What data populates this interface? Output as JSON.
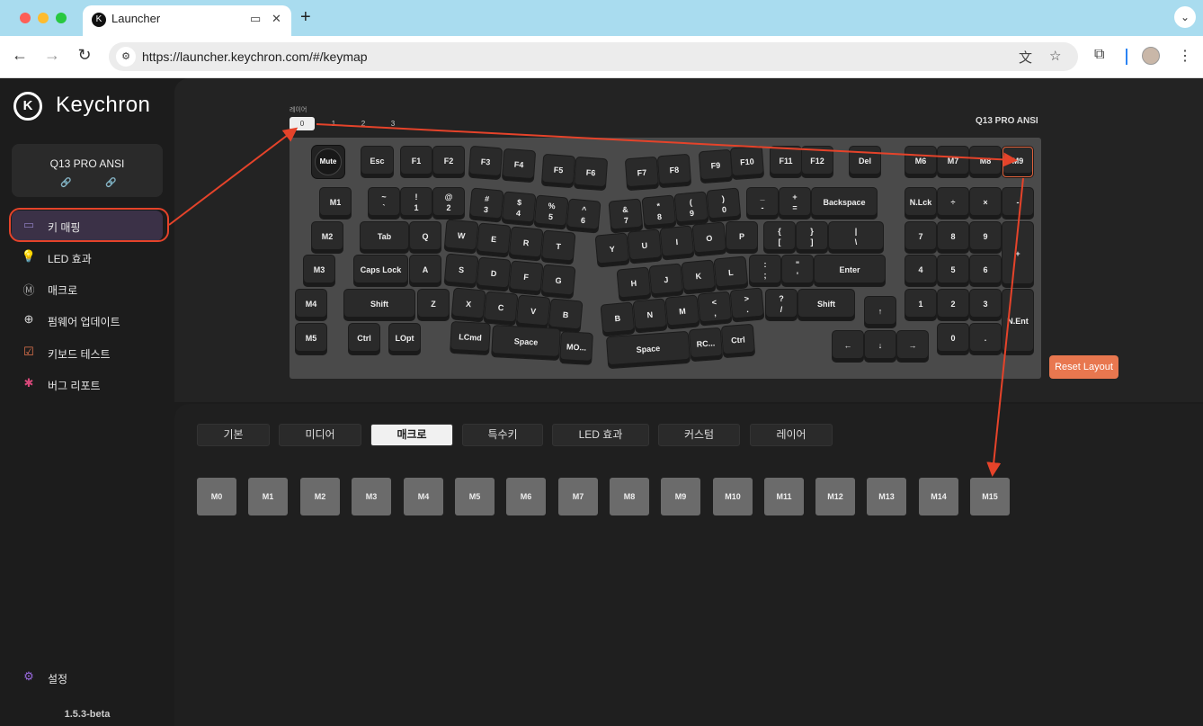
{
  "browser": {
    "tab_title": "Launcher",
    "url": "https://launcher.keychron.com/#/keymap"
  },
  "sidebar": {
    "brand": "Keychron",
    "device_name": "Q13 PRO ANSI",
    "items": [
      {
        "label": "키 매핑",
        "icon": "keyboard-icon"
      },
      {
        "label": "LED 효과",
        "icon": "bulb-icon"
      },
      {
        "label": "매크로",
        "icon": "macro-icon"
      },
      {
        "label": "펌웨어 업데이트",
        "icon": "firmware-icon"
      },
      {
        "label": "키보드 테스트",
        "icon": "checklist-icon"
      },
      {
        "label": "버그 리포트",
        "icon": "bug-icon"
      }
    ],
    "settings": "설정",
    "version": "1.5.3-beta"
  },
  "keymap": {
    "layer_label": "레이어",
    "layers": [
      "0",
      "1",
      "2",
      "3"
    ],
    "selected_layer": "0",
    "keyboard_title": "Q13 PRO ANSI",
    "knob_label": "Mute",
    "reset_label": "Reset Layout"
  },
  "keys": [
    {
      "label": "Esc"
    },
    {
      "label": "F1"
    },
    {
      "label": "F2"
    },
    {
      "label": "F3"
    },
    {
      "label": "F4"
    },
    {
      "label": "F5"
    },
    {
      "label": "F6"
    },
    {
      "label": "F7"
    },
    {
      "label": "F8"
    },
    {
      "label": "F9"
    },
    {
      "label": "F10"
    },
    {
      "label": "F11"
    },
    {
      "label": "F12"
    },
    {
      "label": "Del"
    },
    {
      "label": "M6"
    },
    {
      "label": "M7"
    },
    {
      "label": "M8"
    },
    {
      "label": "M9"
    },
    {
      "label": "M1"
    },
    {
      "label": "~\n`"
    },
    {
      "label": "!\n1"
    },
    {
      "label": "@\n2"
    },
    {
      "label": "#\n3"
    },
    {
      "label": "$\n4"
    },
    {
      "label": "%\n5"
    },
    {
      "label": "^\n6"
    },
    {
      "label": "&\n7"
    },
    {
      "label": "*\n8"
    },
    {
      "label": "(\n9"
    },
    {
      "label": ")\n0"
    },
    {
      "label": "_\n-"
    },
    {
      "label": "+\n="
    },
    {
      "label": "Backspace"
    },
    {
      "label": "N.Lck"
    },
    {
      "label": "÷"
    },
    {
      "label": "×"
    },
    {
      "label": "-"
    },
    {
      "label": "M2"
    },
    {
      "label": "Tab"
    },
    {
      "label": "Q"
    },
    {
      "label": "W"
    },
    {
      "label": "E"
    },
    {
      "label": "R"
    },
    {
      "label": "T"
    },
    {
      "label": "Y"
    },
    {
      "label": "U"
    },
    {
      "label": "I"
    },
    {
      "label": "O"
    },
    {
      "label": "P"
    },
    {
      "label": "{\n["
    },
    {
      "label": "}\n]"
    },
    {
      "label": "|\n\\"
    },
    {
      "label": "7"
    },
    {
      "label": "8"
    },
    {
      "label": "9"
    },
    {
      "label": "+"
    },
    {
      "label": "M3"
    },
    {
      "label": "Caps Lock"
    },
    {
      "label": "A"
    },
    {
      "label": "S"
    },
    {
      "label": "D"
    },
    {
      "label": "F"
    },
    {
      "label": "G"
    },
    {
      "label": "H"
    },
    {
      "label": "J"
    },
    {
      "label": "K"
    },
    {
      "label": "L"
    },
    {
      "label": ":\n;"
    },
    {
      "label": "\"\n'"
    },
    {
      "label": "Enter"
    },
    {
      "label": "4"
    },
    {
      "label": "5"
    },
    {
      "label": "6"
    },
    {
      "label": "M4"
    },
    {
      "label": "Shift"
    },
    {
      "label": "Z"
    },
    {
      "label": "X"
    },
    {
      "label": "C"
    },
    {
      "label": "V"
    },
    {
      "label": "B"
    },
    {
      "label": "B"
    },
    {
      "label": "N"
    },
    {
      "label": "M"
    },
    {
      "label": "<\n,"
    },
    {
      "label": ">\n."
    },
    {
      "label": "?\n/"
    },
    {
      "label": "Shift"
    },
    {
      "label": "↑"
    },
    {
      "label": "1"
    },
    {
      "label": "2"
    },
    {
      "label": "3"
    },
    {
      "label": "N.Ent"
    },
    {
      "label": "M5"
    },
    {
      "label": "Ctrl"
    },
    {
      "label": "LOpt"
    },
    {
      "label": "LCmd"
    },
    {
      "label": "Space"
    },
    {
      "label": "MO..."
    },
    {
      "label": "Space"
    },
    {
      "label": "RC..."
    },
    {
      "label": "Ctrl"
    },
    {
      "label": "←"
    },
    {
      "label": "↓"
    },
    {
      "label": "→"
    },
    {
      "label": "0"
    },
    {
      "label": "."
    }
  ],
  "categories": [
    "기본",
    "미디어",
    "매크로",
    "특수키",
    "LED 효과",
    "커스텀",
    "레이어"
  ],
  "selected_category": "매크로",
  "macros": [
    "M0",
    "M1",
    "M2",
    "M3",
    "M4",
    "M5",
    "M6",
    "M7",
    "M8",
    "M9",
    "M10",
    "M11",
    "M12",
    "M13",
    "M14",
    "M15"
  ],
  "colors": {
    "accent": "#e8774f",
    "annotation": "#e5432a",
    "sidebar_active": "#3b3147"
  }
}
